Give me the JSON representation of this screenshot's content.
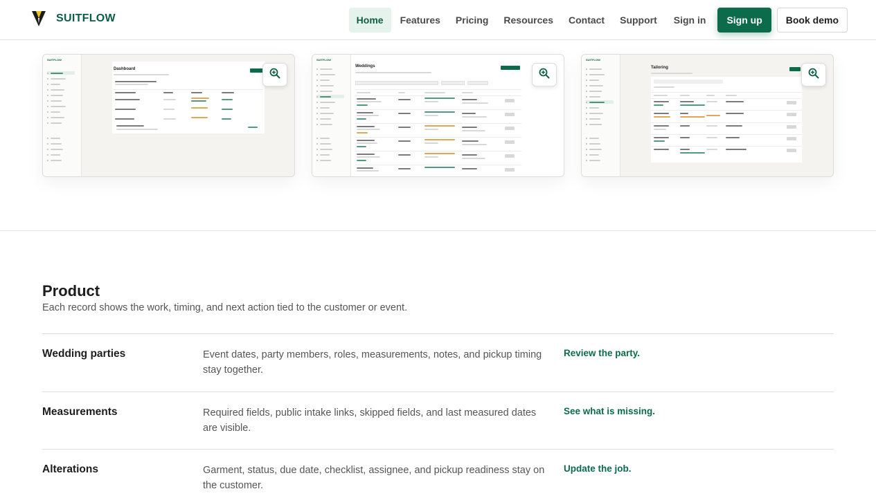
{
  "brand": {
    "name": "SUITFLOW",
    "icon": "lapel-logo-icon",
    "color": "#0b5e43"
  },
  "nav": {
    "links": [
      "Home",
      "Features",
      "Pricing",
      "Resources",
      "Contact",
      "Support"
    ],
    "active": "Home",
    "sign_in": "Sign in",
    "sign_up": "Sign up",
    "book_demo": "Book demo"
  },
  "colors": {
    "accent": "#0b6b4a",
    "accent_light": "#e6f2ec",
    "muted_text": "#555555"
  },
  "screenshots": [
    {
      "title": "Dashboard",
      "zoom_icon": "zoom-in-icon"
    },
    {
      "title": "Weddings",
      "zoom_icon": "zoom-in-icon"
    },
    {
      "title": "Tailoring",
      "zoom_icon": "zoom-in-icon"
    }
  ],
  "product": {
    "title": "Product",
    "subtitle": "Each record shows the work, timing, and next action tied to the customer or event.",
    "rows": [
      {
        "name": "Wedding parties",
        "description": "Event dates, party members, roles, measurements, notes, and pickup timing stay together.",
        "action": "Review the party."
      },
      {
        "name": "Measurements",
        "description": "Required fields, public intake links, skipped fields, and last measured dates are visible.",
        "action": "See what is missing."
      },
      {
        "name": "Alterations",
        "description": "Garment, status, due date, checklist, assignee, and pickup readiness stay on the customer.",
        "action": "Update the job."
      }
    ]
  }
}
